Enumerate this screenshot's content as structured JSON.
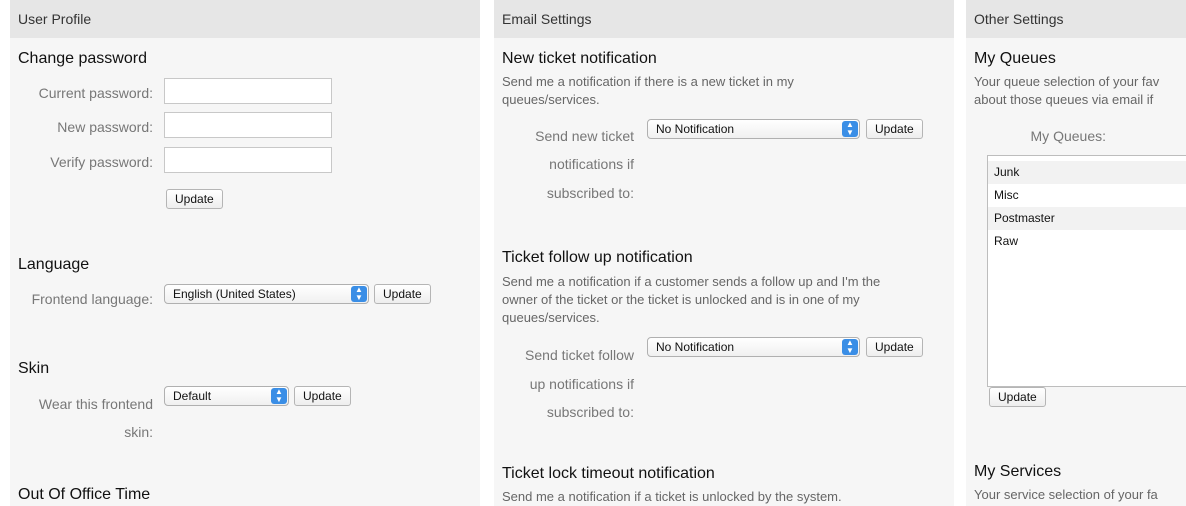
{
  "user_profile": {
    "header": "User Profile",
    "change_password": {
      "title": "Change password",
      "current_label": "Current password:",
      "new_label": "New password:",
      "verify_label": "Verify password:",
      "update_label": "Update"
    },
    "language": {
      "title": "Language",
      "label": "Frontend language:",
      "selected": "English (United States)",
      "update_label": "Update"
    },
    "skin": {
      "title": "Skin",
      "label_line1": "Wear this frontend",
      "label_line2": "skin:",
      "selected": "Default",
      "update_label": "Update"
    },
    "out_of_office": {
      "title": "Out Of Office Time"
    }
  },
  "email_settings": {
    "header": "Email Settings",
    "new_ticket": {
      "title": "New ticket notification",
      "desc_line1": "Send me a notification if there is a new ticket in my",
      "desc_line2": "queues/services.",
      "label_line1": "Send new ticket",
      "label_line2": "notifications if",
      "label_line3": "subscribed to:",
      "selected": "No Notification",
      "update_label": "Update"
    },
    "follow_up": {
      "title": "Ticket follow up notification",
      "desc_line1": "Send me a notification if a customer sends a follow up and I'm the",
      "desc_line2": "owner of the ticket or the ticket is unlocked and is in one of my",
      "desc_line3": "queues/services.",
      "label_line1": "Send ticket follow",
      "label_line2": "up notifications if",
      "label_line3": "subscribed to:",
      "selected": "No Notification",
      "update_label": "Update"
    },
    "lock_timeout": {
      "title": "Ticket lock timeout notification",
      "desc_line1": "Send me a notification if a ticket is unlocked by the system."
    }
  },
  "other_settings": {
    "header": "Other Settings",
    "my_queues": {
      "title": "My Queues",
      "desc_line1": "Your queue selection of your fav",
      "desc_line2": "about those queues via email if",
      "label": "My Queues:",
      "items": [
        "Junk",
        "Misc",
        "Postmaster",
        "Raw"
      ],
      "update_label": "Update"
    },
    "my_services": {
      "title": "My Services",
      "desc_line1": "Your service selection of your fa"
    }
  },
  "colors": {
    "panel_bg": "#f6f6f6",
    "header_bg": "#e6e6e6",
    "select_accent": "#3a8ee6"
  }
}
